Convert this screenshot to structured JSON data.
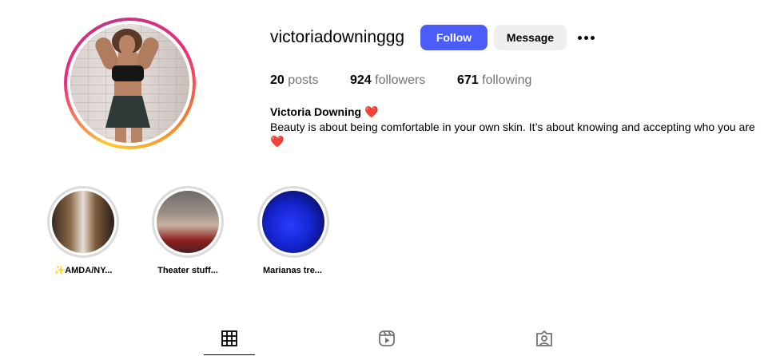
{
  "profile": {
    "username": "victoriadowninggg",
    "full_name": "Victoria Downing",
    "full_name_emoji": "❤️",
    "bio_line1": "Beauty is about being comfortable in your own skin. It’s about knowing and accepting who you are",
    "bio_line2": "❤️"
  },
  "actions": {
    "follow_label": "Follow",
    "message_label": "Message",
    "more_icon": "more-horizontal-icon"
  },
  "stats": {
    "posts_count": "20",
    "posts_label": "posts",
    "followers_count": "924",
    "followers_label": "followers",
    "following_count": "671",
    "following_label": "following"
  },
  "highlights": [
    {
      "label": "✨AMDA/NY..."
    },
    {
      "label": "Theater stuff..."
    },
    {
      "label": "Marianas tre..."
    }
  ],
  "tabs": [
    {
      "icon": "grid-icon",
      "active": true
    },
    {
      "icon": "reels-icon",
      "active": false
    },
    {
      "icon": "tagged-icon",
      "active": false
    }
  ],
  "colors": {
    "accent": "#4a5df9",
    "secondary_button": "#efefef",
    "muted_text": "#737373"
  }
}
